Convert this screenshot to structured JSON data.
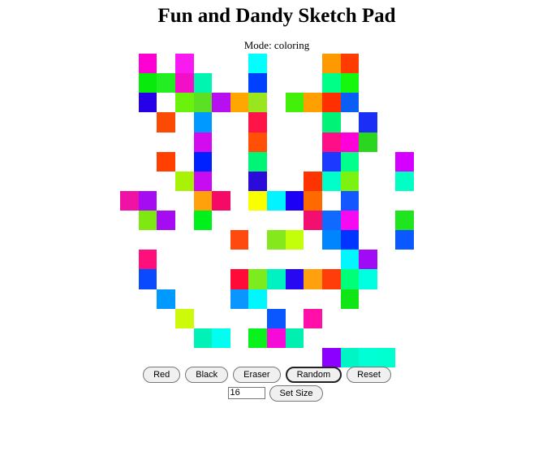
{
  "title": "Fun and Dandy Sketch Pad",
  "mode_text": "Mode: coloring",
  "grid": {
    "size": 16,
    "colors": [
      [
        null,
        "#ff00d4",
        null,
        "#f91af1",
        null,
        null,
        null,
        "#00ffff",
        null,
        null,
        null,
        "#ff9900",
        "#ff3c00",
        null,
        null,
        null
      ],
      [
        null,
        "#07ea0c",
        "#22ee22",
        "#f20fc8",
        "#00f5b0",
        null,
        null,
        "#0041ff",
        null,
        null,
        null,
        "#00ff86",
        "#15f70f",
        null,
        null,
        null
      ],
      [
        null,
        "#2600e8",
        null,
        "#6af20c",
        "#5ce024",
        "#b80ef2",
        "#ffa600",
        "#99e61e",
        null,
        "#42f00a",
        "#ffa000",
        "#ff2f00",
        "#0a5ef5",
        null,
        null,
        null
      ],
      [
        null,
        null,
        "#fa4a04",
        null,
        "#0099ff",
        null,
        null,
        "#ff1447",
        null,
        null,
        null,
        "#00f277",
        null,
        "#1b2ef5",
        null,
        null
      ],
      [
        null,
        null,
        null,
        null,
        "#d30cf0",
        null,
        null,
        "#ff5005",
        null,
        null,
        null,
        "#ff0f87",
        "#ff00d9",
        "#2ad620",
        null,
        null
      ],
      [
        null,
        null,
        "#ff4000",
        null,
        "#0021ff",
        null,
        null,
        "#00f576",
        null,
        null,
        null,
        "#1c3aff",
        "#00ff8c",
        null,
        null,
        "#d500ff"
      ],
      [
        null,
        null,
        null,
        "#a8f205",
        "#c70cf2",
        null,
        null,
        "#2b0bda",
        null,
        null,
        "#ff3300",
        "#00ffc8",
        "#7cf211",
        null,
        null,
        "#00ffc4"
      ],
      [
        "#f012a4",
        "#a60cf2",
        null,
        null,
        "#ffa10a",
        "#f50a65",
        null,
        "#faff00",
        "#00f3ff",
        "#1b00f5",
        "#ff6a00",
        null,
        "#1257ff",
        null,
        null,
        null
      ],
      [
        null,
        "#7fe811",
        "#a60cf2",
        null,
        "#00f01c",
        null,
        null,
        null,
        null,
        null,
        "#f20f6f",
        "#116aff",
        "#f60af2",
        null,
        null,
        "#1fe51f"
      ],
      [
        null,
        null,
        null,
        null,
        null,
        null,
        "#ff4a0f",
        null,
        "#84e81c",
        "#c4ff0a",
        null,
        "#0085ff",
        "#0034ff",
        null,
        null,
        "#0a58ff"
      ],
      [
        null,
        "#ff0f7b",
        null,
        null,
        null,
        null,
        null,
        null,
        null,
        null,
        null,
        null,
        "#00f7ff",
        "#a10af5",
        null,
        null
      ],
      [
        null,
        "#0a4aff",
        null,
        null,
        null,
        null,
        "#ff0a39",
        "#7cec1e",
        "#00f2c2",
        "#2808f0",
        "#ffa00f",
        "#ff3d0a",
        "#00ff78",
        "#00ffe1",
        null,
        null
      ],
      [
        null,
        null,
        "#0099ff",
        null,
        null,
        null,
        "#0a95ff",
        "#00f7ff",
        null,
        null,
        null,
        null,
        "#10e615",
        null,
        null,
        null
      ],
      [
        null,
        null,
        null,
        "#ccfa0a",
        null,
        null,
        null,
        null,
        "#0a57ff",
        null,
        "#ff10a8",
        null,
        null,
        null,
        null,
        null
      ],
      [
        null,
        null,
        null,
        null,
        "#00f2b6",
        "#00fff0",
        null,
        "#0af21d",
        "#f50ad8",
        "#00f0b0",
        null,
        null,
        null,
        null,
        null,
        null
      ],
      [
        null,
        null,
        null,
        null,
        null,
        null,
        null,
        null,
        null,
        null,
        null,
        "#8c00ff",
        "#00f5c4",
        "#00ffd5",
        "#00ffd0",
        null
      ]
    ]
  },
  "buttons": {
    "red": "Red",
    "black": "Black",
    "eraser": "Eraser",
    "random": "Random",
    "reset": "Reset",
    "set_size": "Set Size"
  },
  "size_input": {
    "value": "16"
  }
}
